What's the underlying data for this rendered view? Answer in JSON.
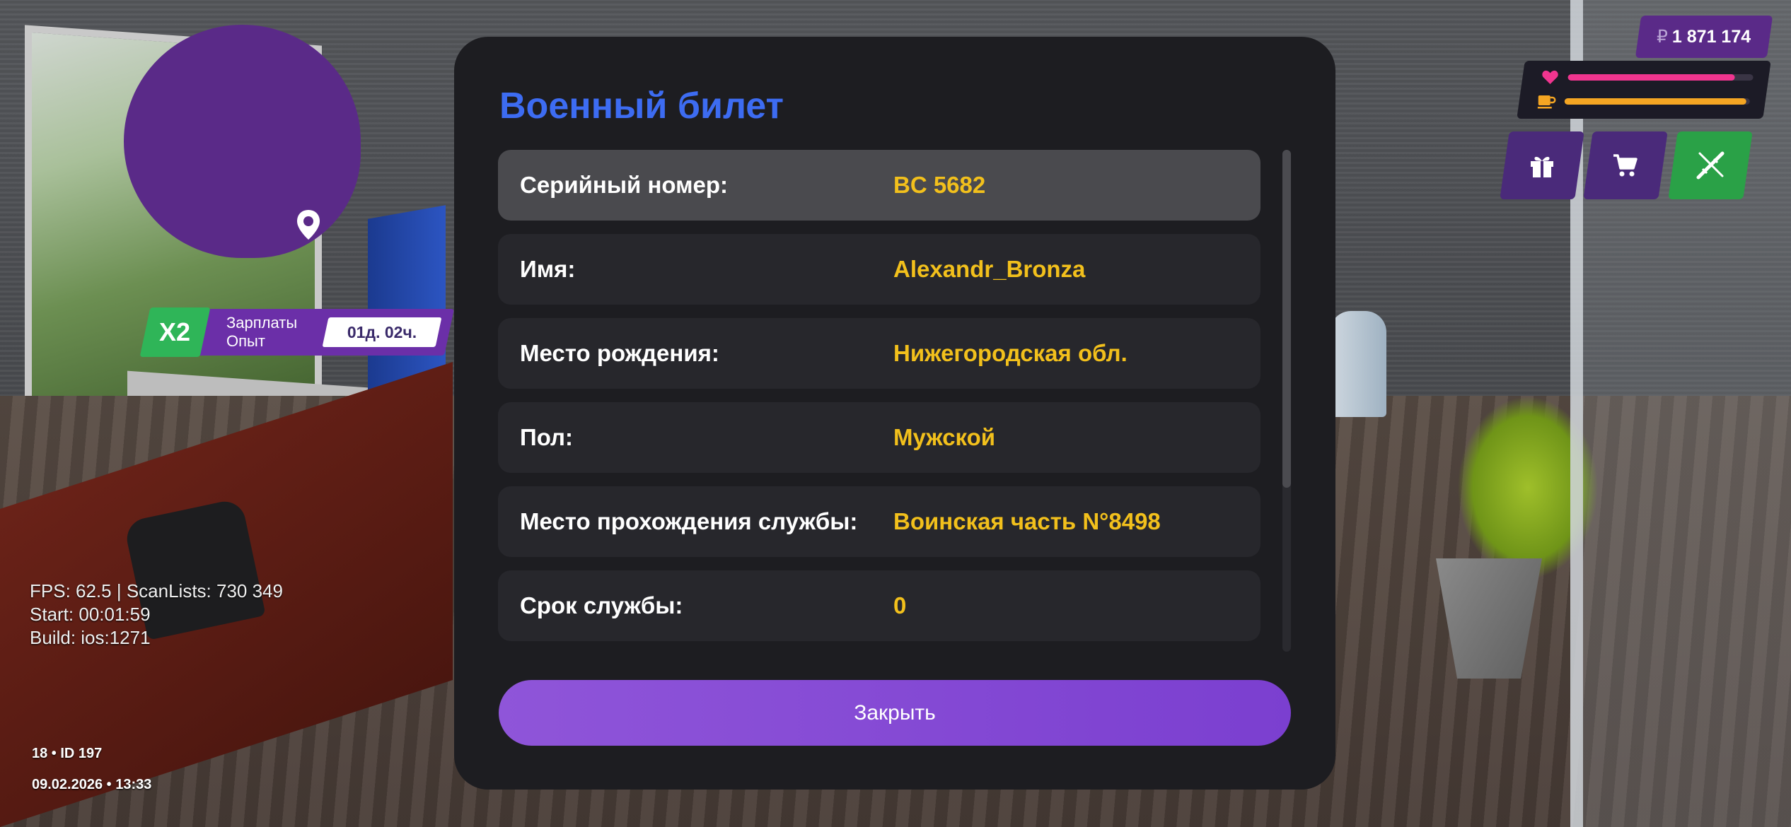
{
  "hud": {
    "money": "1 871 174",
    "money_icon": "ruble-icon",
    "health_level": 0.9,
    "hunger_level": 0.98,
    "health_color": "#f0358f",
    "hunger_color": "#f5a623",
    "buttons": [
      "gift-icon",
      "cart-icon",
      "weapon-icon"
    ]
  },
  "bonus": {
    "multiplier": "X2",
    "line1": "Зарплаты",
    "line2": "Опыт",
    "timer": "01д. 02ч."
  },
  "debug": {
    "line1": "FPS: 62.5 | ScanLists: 730 349",
    "line2": "Start: 00:01:59",
    "line3": "Build: ios:1271"
  },
  "footer": {
    "id_line": "18 • ID 197",
    "datetime": "09.02.2026 • 13:33"
  },
  "dialog": {
    "title": "Военный билет",
    "rows": [
      {
        "label": "Серийный номер:",
        "value": "BC 5682"
      },
      {
        "label": "Имя:",
        "value": "Alexandr_Bronza"
      },
      {
        "label": "Место рождения:",
        "value": "Нижегородская обл."
      },
      {
        "label": "Пол:",
        "value": "Мужской"
      },
      {
        "label": "Место прохождения службы:",
        "value": "Воинская часть N°8498"
      },
      {
        "label": "Срок службы:",
        "value": "0"
      }
    ],
    "close_label": "Закрыть"
  },
  "colors": {
    "title": "#3d6cf2",
    "value": "#f2c01c",
    "accent": "#8f55d9",
    "bonus_green": "#2fb558"
  }
}
